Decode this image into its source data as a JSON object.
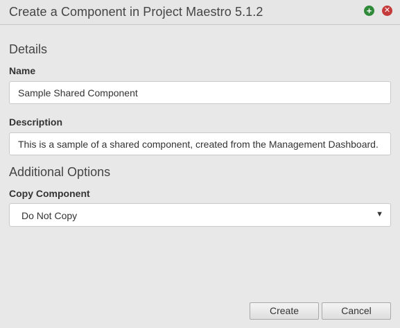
{
  "dialog": {
    "title": "Create a Component in Project Maestro 5.1.2",
    "add_icon_glyph": "+",
    "close_icon_glyph": "✕"
  },
  "details": {
    "heading": "Details",
    "name_label": "Name",
    "name_value": "Sample Shared Component",
    "description_label": "Description",
    "description_value": "This is a sample of a shared component, created from the Management Dashboard."
  },
  "options": {
    "heading": "Additional Options",
    "copy_label": "Copy Component",
    "copy_selected": "Do Not Copy",
    "arrow_glyph": "▼"
  },
  "footer": {
    "create_label": "Create",
    "cancel_label": "Cancel"
  },
  "colors": {
    "add_icon": "#2f8a3a",
    "close_icon": "#c53a3a",
    "background": "#e8e8e8"
  }
}
